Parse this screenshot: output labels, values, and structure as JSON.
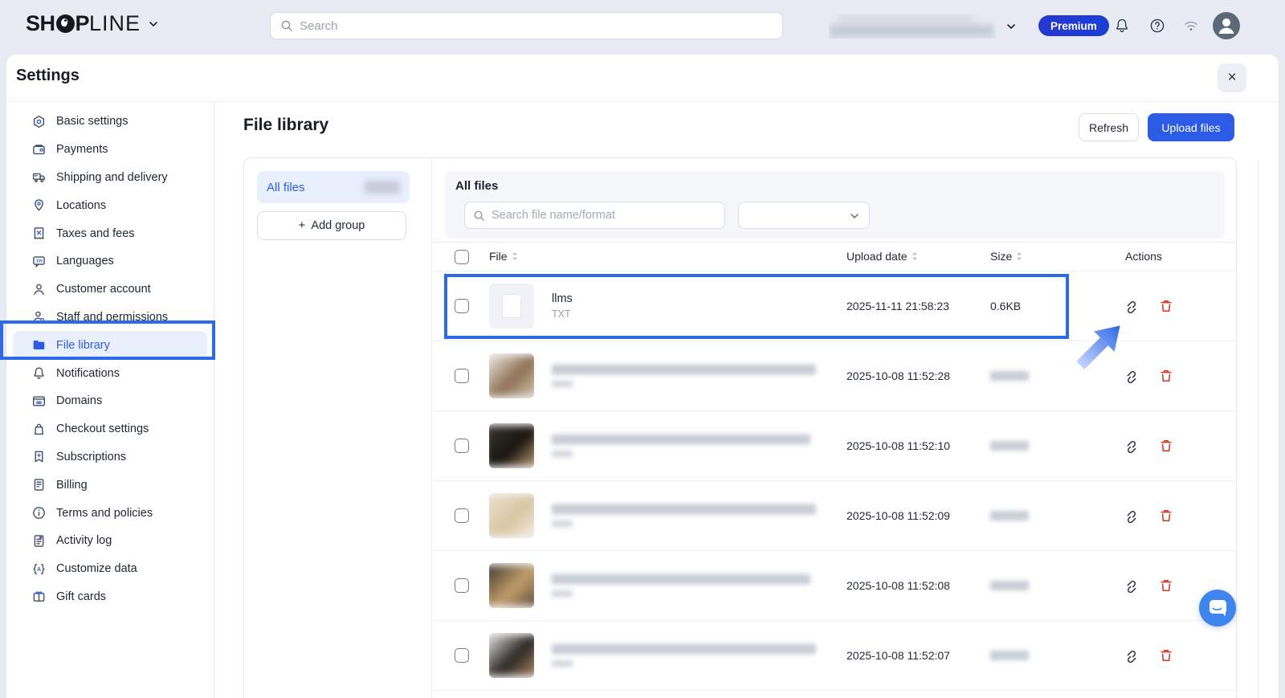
{
  "topbar": {
    "logo": {
      "pre": "SH",
      "o": "O",
      "post": "P",
      "rest": "LINE"
    },
    "search_placeholder": "Search",
    "premium_label": "Premium"
  },
  "settings_panel": {
    "title": "Settings",
    "close_label": "×"
  },
  "sidebar": {
    "items": [
      {
        "label": "Basic settings",
        "icon": "basic"
      },
      {
        "label": "Payments",
        "icon": "payments"
      },
      {
        "label": "Shipping and delivery",
        "icon": "shipping"
      },
      {
        "label": "Locations",
        "icon": "locations"
      },
      {
        "label": "Taxes and fees",
        "icon": "taxes"
      },
      {
        "label": "Languages",
        "icon": "languages"
      },
      {
        "label": "Customer account",
        "icon": "customer"
      },
      {
        "label": "Staff and permissions",
        "icon": "staff"
      },
      {
        "label": "File library",
        "icon": "folder",
        "selected": true
      },
      {
        "label": "Notifications",
        "icon": "bell"
      },
      {
        "label": "Domains",
        "icon": "domains"
      },
      {
        "label": "Checkout settings",
        "icon": "checkout"
      },
      {
        "label": "Subscriptions",
        "icon": "subscriptions"
      },
      {
        "label": "Billing",
        "icon": "billing"
      },
      {
        "label": "Terms and policies",
        "icon": "terms"
      },
      {
        "label": "Activity log",
        "icon": "activity"
      },
      {
        "label": "Customize data",
        "icon": "customize"
      },
      {
        "label": "Gift cards",
        "icon": "gift"
      }
    ]
  },
  "main": {
    "title": "File library",
    "refresh_label": "Refresh",
    "upload_label": "Upload files",
    "groups": {
      "all_files_tab": "All files",
      "add_group_plus": "+",
      "add_group_label": "Add group"
    },
    "filter": {
      "title": "All files",
      "search_placeholder": "Search file name/format"
    },
    "table": {
      "columns": [
        {
          "label": "File",
          "sortable": true
        },
        {
          "label": "Upload date",
          "sortable": true
        },
        {
          "label": "Size",
          "sortable": true
        },
        {
          "label": "Actions",
          "sortable": false
        }
      ],
      "rows": [
        {
          "name": "llms",
          "format": "TXT",
          "upload_date": "2025-11-11 21:58:23",
          "size": "0.6KB",
          "redacted": false,
          "thumb": "file",
          "highlighted": true
        },
        {
          "upload_date": "2025-10-08 11:52:28",
          "redacted": true,
          "thumb_colors": [
            "#f2f1ee",
            "#8e6f52",
            "#d8cfc0"
          ]
        },
        {
          "upload_date": "2025-10-08 11:52:10",
          "redacted": true,
          "thumb_colors": [
            "#3c3834",
            "#17140f",
            "#c9a478"
          ]
        },
        {
          "upload_date": "2025-10-08 11:52:09",
          "redacted": true,
          "thumb_colors": [
            "#ece2cf",
            "#d9c5a2",
            "#f4efe6"
          ]
        },
        {
          "upload_date": "2025-10-08 11:52:08",
          "redacted": true,
          "thumb_colors": [
            "#33302c",
            "#c49e6b",
            "#56473a"
          ]
        },
        {
          "upload_date": "2025-10-08 11:52:07",
          "redacted": true,
          "thumb_colors": [
            "#efede9",
            "#2a2623",
            "#b28f66"
          ]
        }
      ]
    }
  },
  "colors": {
    "accent": "#2c5ce5",
    "annotation": "#2b6be8",
    "danger": "#d5311d",
    "selected_bg": "#e9effd",
    "topbar_bg": "#e9ebf4"
  }
}
